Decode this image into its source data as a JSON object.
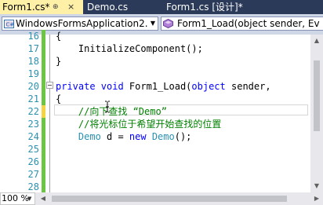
{
  "tabs": [
    {
      "label": "Form1.cs*",
      "pin": "⊕",
      "close": "×"
    },
    {
      "label": "Demo.cs"
    },
    {
      "label": "Form1.cs [设计]*"
    }
  ],
  "nav": {
    "class_dropdown": "WindowsFormsApplication2.F",
    "member_dropdown": "Form1_Load(object sender, Ev"
  },
  "code_lines": [
    {
      "num": "16",
      "text": "{"
    },
    {
      "num": "17",
      "text": "    InitializeComponent();"
    },
    {
      "num": "18",
      "text": "}"
    },
    {
      "num": "19",
      "text": ""
    },
    {
      "num": "20",
      "kw": "private void ",
      "text": "Form1_Load(",
      "kw2": "object",
      "text2": " sender,"
    },
    {
      "num": "21",
      "text": "{"
    },
    {
      "num": "22",
      "comment": "    //向下查找 “Demo”"
    },
    {
      "num": "23",
      "comment": "    //将光标位于希望开始查找的位置"
    },
    {
      "num": "24",
      "type": "    Demo",
      "text": " d = ",
      "kw": "new ",
      "type2": "Demo",
      "text2": "();"
    },
    {
      "num": "25",
      "text": ""
    },
    {
      "num": "26",
      "text": ""
    },
    {
      "num": "27",
      "text": ""
    },
    {
      "num": "28",
      "text": ""
    }
  ],
  "zoom": "100 %",
  "colors": {
    "tab_active_bg": "#fff0a8",
    "tabstrip_bg": "#2b3a58",
    "keyword": "#0000ff",
    "type": "#2b91af",
    "comment": "#008000",
    "changed_saved": "#6cc644",
    "changed_unsaved": "#f4d442"
  },
  "icons": {
    "class_dropdown": "csharp-project-icon",
    "member_dropdown": "method-icon",
    "text_cursor": "ibeam-cursor-icon"
  }
}
